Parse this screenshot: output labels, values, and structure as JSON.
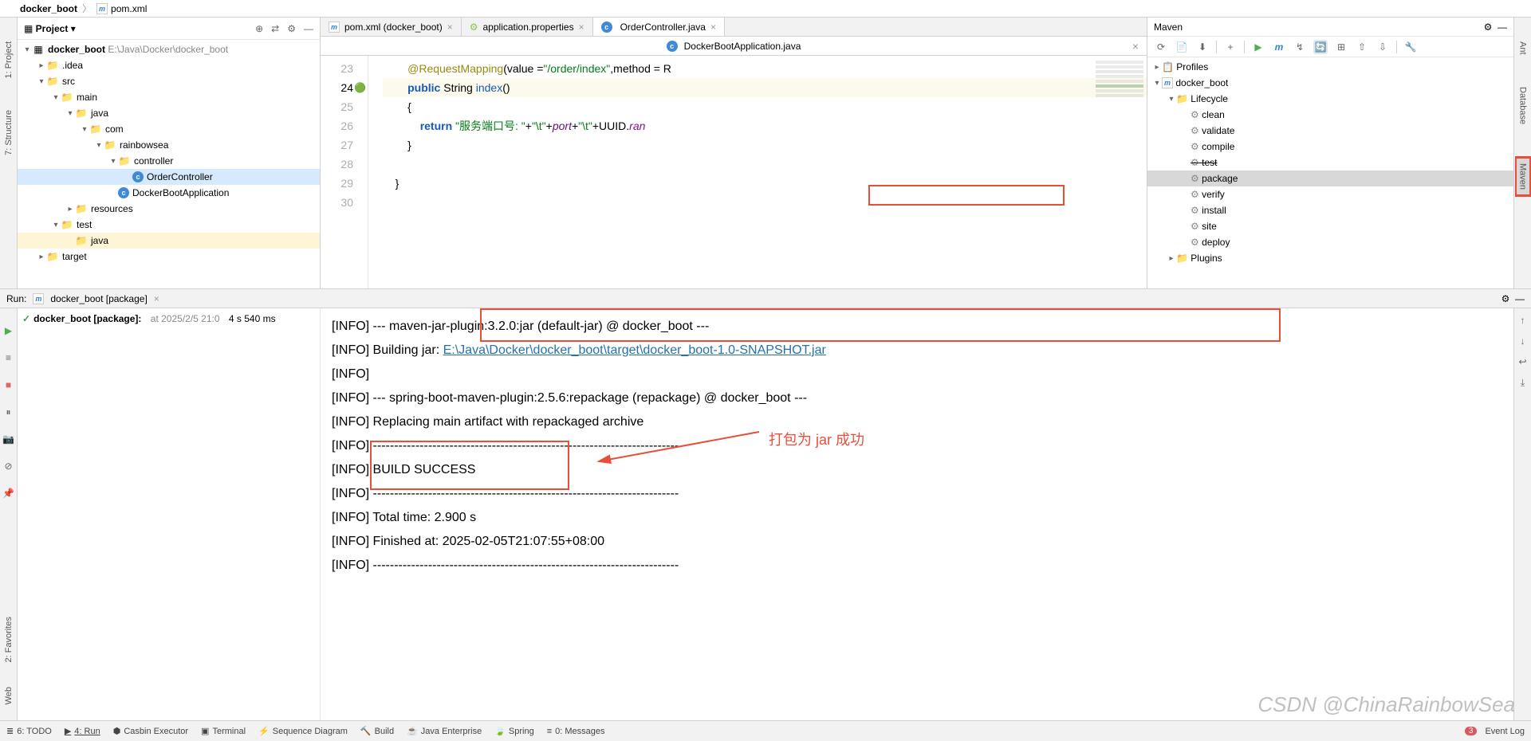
{
  "breadcrumb": {
    "project": "docker_boot",
    "file": "pom.xml"
  },
  "leftGutter": {
    "project": "1: Project",
    "structure": "7: Structure"
  },
  "leftGutterBottom": {
    "favorites": "2: Favorites",
    "web": "Web"
  },
  "rightGutter": {
    "ant": "Ant",
    "database": "Database",
    "maven": "Maven"
  },
  "projectPanel": {
    "title": "Project",
    "tree": {
      "root": "docker_boot",
      "rootPath": "E:\\Java\\Docker\\docker_boot",
      "idea": ".idea",
      "src": "src",
      "main": "main",
      "java": "java",
      "com": "com",
      "rainbowsea": "rainbowsea",
      "controller": "controller",
      "orderController": "OrderController",
      "dockerBootApp": "DockerBootApplication",
      "resources": "resources",
      "test": "test",
      "testJava": "java",
      "target": "target"
    }
  },
  "editorTabs": {
    "tab1": "pom.xml (docker_boot)",
    "tab2": "application.properties",
    "tab3": "OrderController.java",
    "subtab": "DockerBootApplication.java"
  },
  "code": {
    "l23a": "@RequestMapping",
    "l23b": "(value =",
    "l23c": "\"/order/index\"",
    "l23d": ",method = R",
    "l24a": "public",
    "l24b": " String ",
    "l24c": "index",
    "l24d": "()",
    "l25": "{",
    "l26a": "return",
    "l26b": " ",
    "l26c": "\"服务端口号: \"",
    "l26d": "+",
    "l26e": "\"\\t\"",
    "l26f": "+",
    "l26g": "port",
    "l26h": "+",
    "l26i": "\"\\t\"",
    "l26j": "+UUID.",
    "l26k": "ran",
    "l27": "}",
    "l28": "",
    "l29": "}",
    "l30": "",
    "lines": {
      "23": "23",
      "24": "24",
      "25": "25",
      "26": "26",
      "27": "27",
      "28": "28",
      "29": "29",
      "30": "30"
    }
  },
  "maven": {
    "title": "Maven",
    "profiles": "Profiles",
    "project": "docker_boot",
    "lifecycle": "Lifecycle",
    "clean": "clean",
    "validate": "validate",
    "compile": "compile",
    "test": "test",
    "package": "package",
    "verify": "verify",
    "install": "install",
    "site": "site",
    "deploy": "deploy",
    "plugins": "Plugins"
  },
  "run": {
    "title": "Run:",
    "config": "docker_boot [package]",
    "treeRoot": "docker_boot [package]:",
    "treeInfo": "at 2025/2/5 21:0",
    "treeTime": "4 s 540 ms"
  },
  "console": {
    "l1": "[INFO] --- maven-jar-plugin:3.2.0:jar (default-jar) @ docker_boot ---",
    "l2a": "[INFO] Building jar: ",
    "l2b": "E:\\Java\\Docker\\docker_boot\\target\\docker_boot-1.0-SNAPSHOT.jar",
    "l3": "[INFO]",
    "l4": "[INFO] --- spring-boot-maven-plugin:2.5.6:repackage (repackage) @ docker_boot ---",
    "l5": "[INFO] Replacing main artifact with repackaged archive",
    "l6": "[INFO] ------------------------------------------------------------------------",
    "l7": "[INFO] BUILD SUCCESS",
    "l8": "[INFO] ------------------------------------------------------------------------",
    "l9": "[INFO] Total time:  2.900 s",
    "l10": "[INFO] Finished at: 2025-02-05T21:07:55+08:00",
    "l11": "[INFO] ------------------------------------------------------------------------"
  },
  "annotation": {
    "text": "打包为 jar 成功"
  },
  "statusBar": {
    "todo": "6: TODO",
    "run": "4: Run",
    "casbin": "Casbin Executor",
    "terminal": "Terminal",
    "sequence": "Sequence Diagram",
    "build": "Build",
    "javaee": "Java Enterprise",
    "spring": "Spring",
    "messages": "0: Messages",
    "eventLog": "Event Log",
    "badge": "3"
  },
  "watermark": "CSDN @ChinaRainbowSea"
}
